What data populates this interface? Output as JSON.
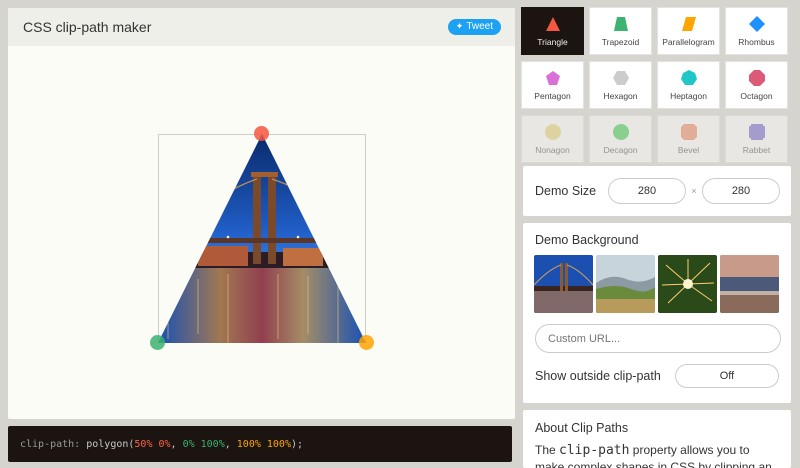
{
  "header": {
    "title": "CSS clip-path maker",
    "tweet_label": "Tweet"
  },
  "shapes": [
    {
      "label": "Triangle",
      "color": "#f4563f",
      "icon": "triangle-icon",
      "active": true
    },
    {
      "label": "Trapezoid",
      "color": "#3cb371",
      "icon": "trapezoid-icon"
    },
    {
      "label": "Parallelogram",
      "color": "#ffa500",
      "icon": "parallelogram-icon"
    },
    {
      "label": "Rhombus",
      "color": "#1e90ff",
      "icon": "rhombus-icon"
    },
    {
      "label": "Pentagon",
      "color": "#da70d6",
      "icon": "pentagon-icon"
    },
    {
      "label": "Hexagon",
      "color": "#cccccc",
      "icon": "hexagon-icon"
    },
    {
      "label": "Heptagon",
      "color": "#20c7c7",
      "icon": "heptagon-icon"
    },
    {
      "label": "Octagon",
      "color": "#dc5a78",
      "icon": "octagon-icon"
    },
    {
      "label": "Nonagon",
      "color": "#e6d36a",
      "icon": "nonagon-icon"
    },
    {
      "label": "Decagon",
      "color": "#2ecc40",
      "icon": "decagon-icon"
    },
    {
      "label": "Bevel",
      "color": "#f0805a",
      "icon": "bevel-icon"
    },
    {
      "label": "Rabbet",
      "color": "#6a5acd",
      "icon": "rabbet-icon"
    }
  ],
  "demo_size": {
    "label": "Demo Size",
    "width": "280",
    "separator": "×",
    "height": "280"
  },
  "demo_background": {
    "label": "Demo Background",
    "thumbnails": [
      "bridge-night-thumbnail",
      "hills-landscape-thumbnail",
      "sparkler-thumbnail",
      "beach-sunset-thumbnail"
    ],
    "custom_url_placeholder": "Custom URL...",
    "show_outside_label": "Show outside clip-path",
    "show_outside_value": "Off"
  },
  "about": {
    "title": "About Clip Paths",
    "text_before": "The ",
    "code": "clip-path",
    "text_after": " property allows you to make complex shapes in CSS by clipping an element"
  },
  "code_bar": {
    "property": "clip-path:",
    "fn_open": " polygon(",
    "p1": "50% 0%",
    "sep1": ", ",
    "p2": "0% 100%",
    "sep2": ", ",
    "p3": "100% 100%",
    "fn_close": ");"
  },
  "colors": {
    "accent_red": "#f4563f",
    "accent_green": "#3cb371",
    "accent_orange": "#ffa500",
    "tweet_blue": "#1da1f2",
    "dark": "#1b1411"
  }
}
